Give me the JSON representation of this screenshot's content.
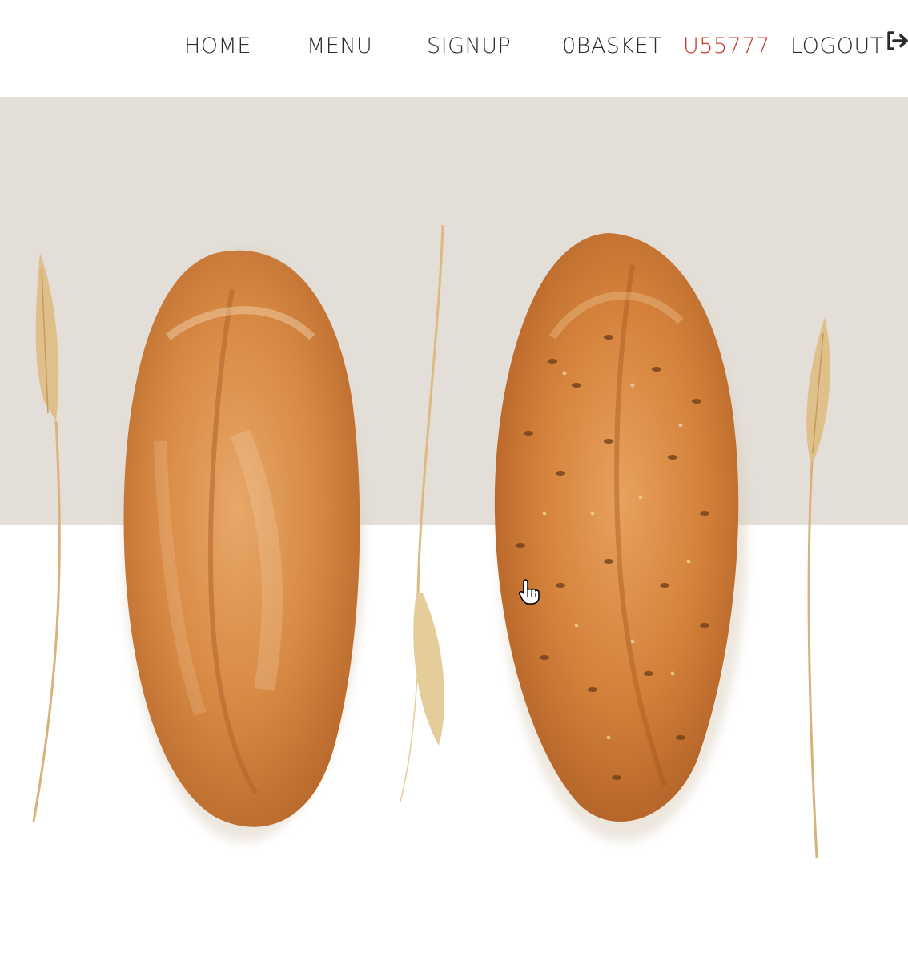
{
  "nav": {
    "home_label": "HOME",
    "menu_label": "MENU",
    "signup_label": "SIGNUP",
    "basket_label": "0BASKET",
    "user_label": "U55777",
    "logout_label": "LOGOUT",
    "logout_icon": "sign-out-icon"
  },
  "colors": {
    "user_accent": "#c0392b",
    "nav_text": "#2b2b2b",
    "hero_top_bg": "#e3dfd8",
    "hero_bottom_bg": "#ffffff"
  },
  "hero": {
    "image": "two-bread-loaves-with-wheat-stalks",
    "cursor_icon": "hand-pointer-icon"
  }
}
